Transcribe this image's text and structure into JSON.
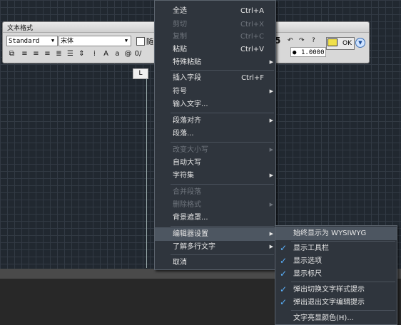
{
  "toolbar": {
    "title": "文本格式",
    "style_value": "Standard",
    "font_value": "宋体",
    "partial_char": "随",
    "track_value": "1.0000",
    "ok_label": "OK",
    "digit_5": "5"
  },
  "ruler_tab_label": "L",
  "main_menu": {
    "items": [
      {
        "label": "全选",
        "shortcut": "Ctrl+A",
        "disabled": false
      },
      {
        "label": "剪切",
        "shortcut": "Ctrl+X",
        "disabled": true
      },
      {
        "label": "复制",
        "shortcut": "Ctrl+C",
        "disabled": true
      },
      {
        "label": "粘贴",
        "shortcut": "Ctrl+V",
        "disabled": false
      },
      {
        "label": "特殊粘贴",
        "shortcut": "",
        "disabled": false,
        "submenu": true
      },
      {
        "label": "插入字段",
        "shortcut": "Ctrl+F",
        "disabled": false
      },
      {
        "label": "符号",
        "shortcut": "",
        "disabled": false,
        "submenu": true
      },
      {
        "label": "输入文字...",
        "shortcut": "",
        "disabled": false
      },
      {
        "label": "段落对齐",
        "shortcut": "",
        "disabled": false,
        "submenu": true
      },
      {
        "label": "段落...",
        "shortcut": "",
        "disabled": false
      },
      {
        "label": "改变大小写",
        "shortcut": "",
        "disabled": true,
        "submenu": true
      },
      {
        "label": "自动大写",
        "shortcut": "",
        "disabled": false
      },
      {
        "label": "字符集",
        "shortcut": "",
        "disabled": false,
        "submenu": true
      },
      {
        "label": "合并段落",
        "shortcut": "",
        "disabled": true
      },
      {
        "label": "删除格式",
        "shortcut": "",
        "disabled": true,
        "submenu": true
      },
      {
        "label": "背景遮罩...",
        "shortcut": "",
        "disabled": false
      },
      {
        "label": "编辑器设置",
        "shortcut": "",
        "disabled": false,
        "submenu": true,
        "active": true
      },
      {
        "label": "了解多行文字",
        "shortcut": "",
        "disabled": false,
        "submenu": true
      },
      {
        "label": "取消",
        "shortcut": "",
        "disabled": false
      }
    ]
  },
  "sub_menu": {
    "items": [
      {
        "label": "始终显示为 WYSIWYG",
        "checked": false
      },
      {
        "label": "显示工具栏",
        "checked": true
      },
      {
        "label": "显示选项",
        "checked": true
      },
      {
        "label": "显示标尺",
        "checked": true
      },
      {
        "label": "弹出切换文字样式提示",
        "checked": true
      },
      {
        "label": "弹出退出文字编辑提示",
        "checked": true
      },
      {
        "label": "文字亮显颜色(H)...",
        "checked": false
      }
    ]
  },
  "colors": {
    "menu_bg": "#2f353d",
    "canvas_bg": "#212830",
    "check": "#5bb3ff"
  }
}
